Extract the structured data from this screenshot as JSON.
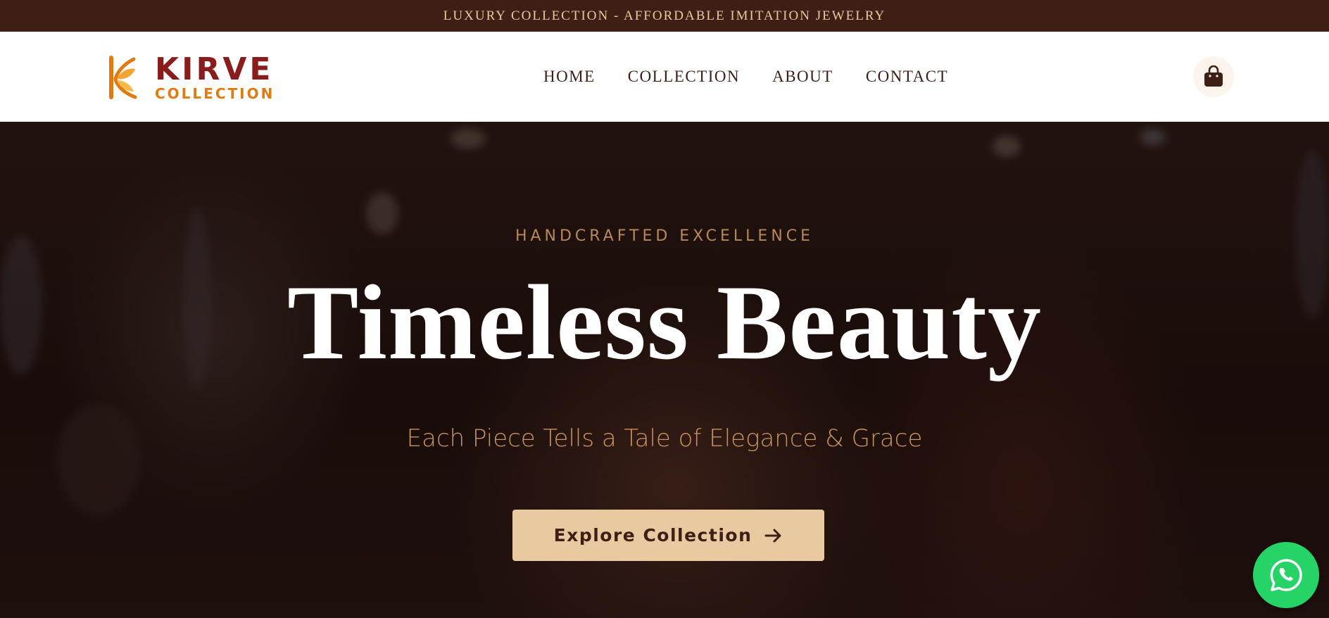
{
  "announcement": {
    "text": "LUXURY COLLECTION - AFFORDABLE IMITATION JEWELRY"
  },
  "brand": {
    "name": "KIRVE",
    "subtitle": "COLLECTION"
  },
  "nav": {
    "items": [
      {
        "label": "HOME"
      },
      {
        "label": "COLLECTION"
      },
      {
        "label": "ABOUT"
      },
      {
        "label": "CONTACT"
      }
    ]
  },
  "icons": {
    "cart": "shopping-bag-icon",
    "cta_arrow": "arrow-right-icon",
    "whatsapp": "whatsapp-icon"
  },
  "hero": {
    "eyebrow": "HANDCRAFTED EXCELLENCE",
    "title": "Timeless Beauty",
    "tagline": "Each Piece Tells a Tale of Elegance & Grace",
    "cta_label": "Explore Collection"
  },
  "colors": {
    "announcement_bg": "#3d1f15",
    "announcement_text": "#e8c9a0",
    "brand_red": "#8a1c1c",
    "brand_orange": "#e07a12",
    "accent_gold": "#c8945e",
    "cta_bg": "#e8c9a0",
    "whatsapp_green": "#25d366"
  }
}
